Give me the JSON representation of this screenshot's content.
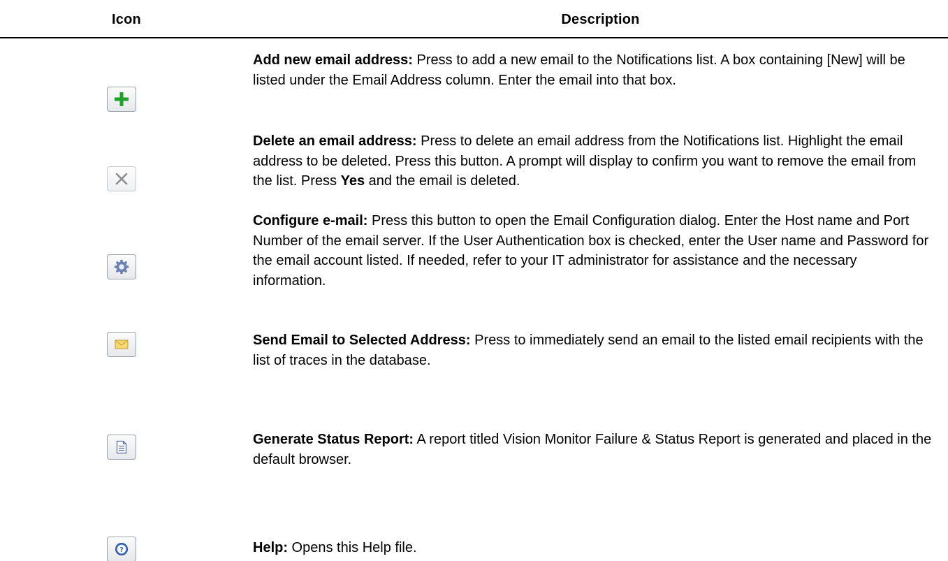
{
  "header": {
    "icon_col": "Icon",
    "desc_col": "Description"
  },
  "rows": [
    {
      "icon": "plus-icon",
      "title": "Add new email address:",
      "text": " Press to add a new email to the Notifications list. A box containing [New] will be listed under the Email Address column. Enter the email into that box."
    },
    {
      "icon": "close-icon",
      "title": "Delete an email address:",
      "text": " Press to delete an email address from the Notifications list. Highlight the email address to be deleted. Press this button. A prompt will display to confirm you want to remove the email from the list. Press ",
      "bold_word": "Yes",
      "text_after": " and the email is deleted."
    },
    {
      "icon": "gear-icon",
      "title": "Configure e-mail:",
      "text": " Press this button to open the Email Configuration dialog. Enter the Host name and Port Number of the email server. If the User Authentication box is checked, enter the User name and Password for the email account listed. If needed, refer to your IT administrator for assistance and the necessary information."
    },
    {
      "icon": "envelope-icon",
      "title": "Send Email to Selected Address:",
      "text": " Press to immediately send an email to the listed email recipients with the list of traces in the database."
    },
    {
      "icon": "report-icon",
      "title": "Generate Status Report:",
      "text": " A report titled Vision Monitor Failure & Status Report is generated and placed in the default browser."
    },
    {
      "icon": "help-icon",
      "title": "Help:",
      "text": " Opens this Help file."
    }
  ],
  "colors": {
    "plus_green": "#1fa12a",
    "close_gray": "#8e8e8e",
    "gear_blue": "#6b7fb3",
    "envelope_yellow": "#f3d873",
    "help_blue": "#3b6cc4"
  }
}
